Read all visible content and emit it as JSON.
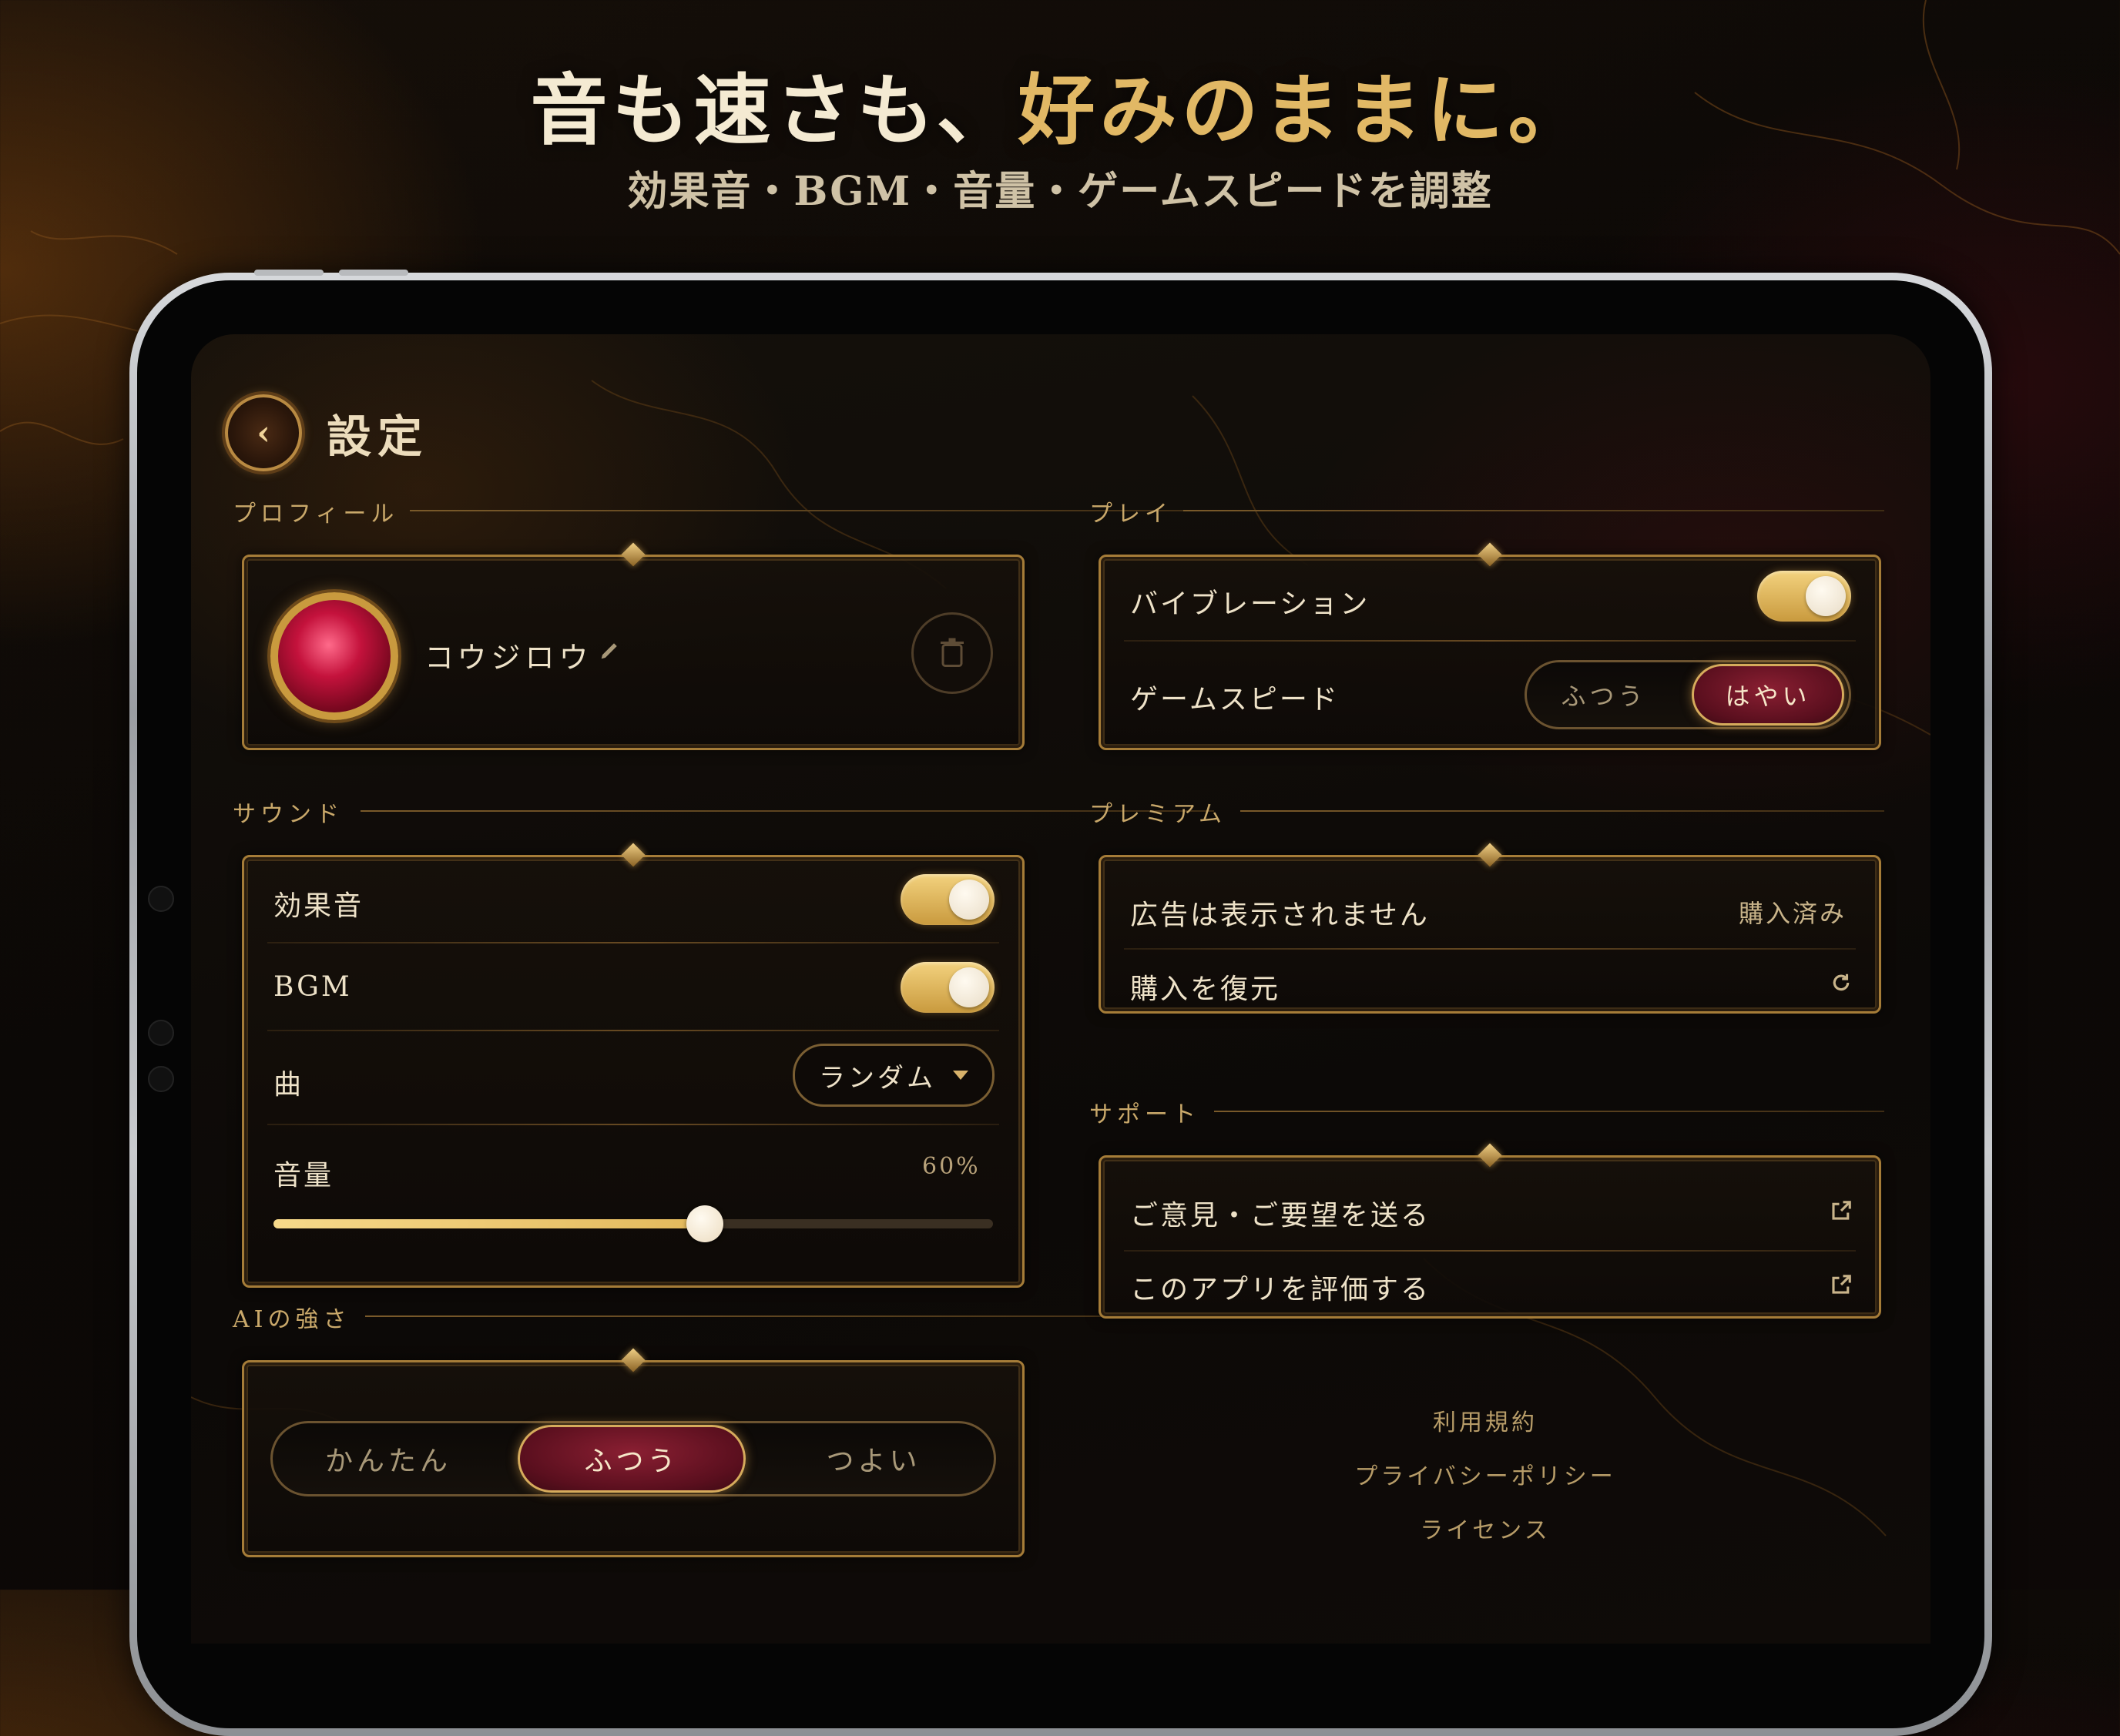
{
  "headline": {
    "main": "音も速さも、",
    "accent": "好みのままに。"
  },
  "subheadline": "効果音・BGM・音量・ゲームスピードを調整",
  "header": {
    "title": "設定",
    "back_icon": "chevron-left-icon"
  },
  "profile": {
    "section_label": "プロフィール",
    "name": "コウジロウ",
    "edit_icon": "pencil-icon",
    "delete_icon": "trash-icon"
  },
  "sound": {
    "section_label": "サウンド",
    "sfx_label": "効果音",
    "sfx_on": true,
    "bgm_label": "BGM",
    "bgm_on": true,
    "song_label": "曲",
    "song_value": "ランダム",
    "volume_label": "音量",
    "volume_value": "60%",
    "volume_fraction": 0.6
  },
  "ai": {
    "section_label": "AIの強さ",
    "options": [
      "かんたん",
      "ふつう",
      "つよい"
    ],
    "selected": "ふつう"
  },
  "play": {
    "section_label": "プレイ",
    "vibration_label": "バイブレーション",
    "vibration_on": true,
    "speed_label": "ゲームスピード",
    "speed_options": [
      "ふつう",
      "はやい"
    ],
    "speed_selected": "はやい"
  },
  "premium": {
    "section_label": "プレミアム",
    "noads_label": "広告は表示されません",
    "noads_status": "購入済み",
    "restore_label": "購入を復元",
    "restore_icon": "refresh-icon"
  },
  "support": {
    "section_label": "サポート",
    "feedback_label": "ご意見・ご要望を送る",
    "rate_label": "このアプリを評価する",
    "external_icon": "external-link-icon"
  },
  "footer": {
    "terms": "利用規約",
    "privacy": "プライバシーポリシー",
    "license": "ライセンス"
  },
  "colors": {
    "gold": "#d6ab5c",
    "ruby": "#8a1f32",
    "background": "#0c0907",
    "text": "#eee2c8"
  }
}
